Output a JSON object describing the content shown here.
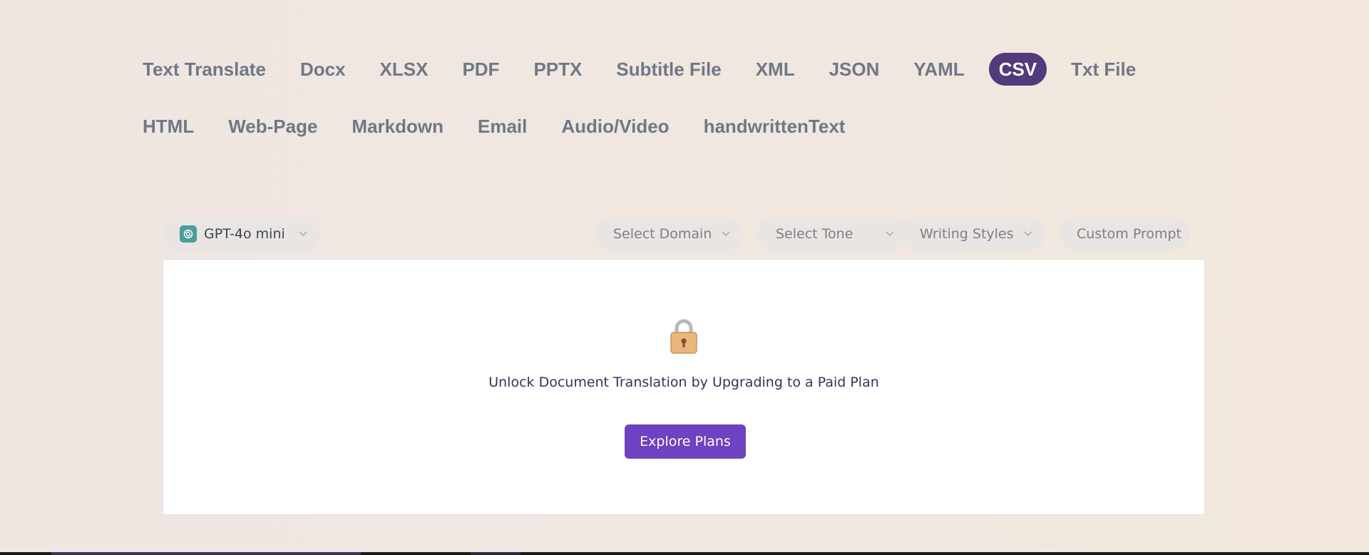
{
  "tabs": [
    {
      "label": "Text Translate"
    },
    {
      "label": "Docx"
    },
    {
      "label": "XLSX"
    },
    {
      "label": "PDF"
    },
    {
      "label": "PPTX"
    },
    {
      "label": "Subtitle File"
    },
    {
      "label": "XML"
    },
    {
      "label": "JSON"
    },
    {
      "label": "YAML"
    },
    {
      "label": "CSV",
      "active": true
    },
    {
      "label": "Txt File"
    },
    {
      "label": "HTML"
    },
    {
      "label": "Web-Page"
    },
    {
      "label": "Markdown"
    },
    {
      "label": "Email"
    },
    {
      "label": "Audio/Video"
    },
    {
      "label": "handwrittenText"
    }
  ],
  "toolbar": {
    "model": {
      "label": "GPT-4o mini",
      "icon": "openai-logo-icon"
    },
    "domain": {
      "placeholder": "Select Domain"
    },
    "tone": {
      "placeholder": "Select Tone"
    },
    "styles": {
      "placeholder": "Writing Styles"
    },
    "custom_prompt": {
      "label": "Custom Prompt"
    }
  },
  "panel": {
    "icon": "lock-icon",
    "message": "Unlock Document Translation by Upgrading to a Paid Plan",
    "button_label": "Explore Plans"
  },
  "colors": {
    "active_tab": "#523a7d",
    "primary_button": "#6f42c1",
    "tab_text": "#6f7884"
  }
}
